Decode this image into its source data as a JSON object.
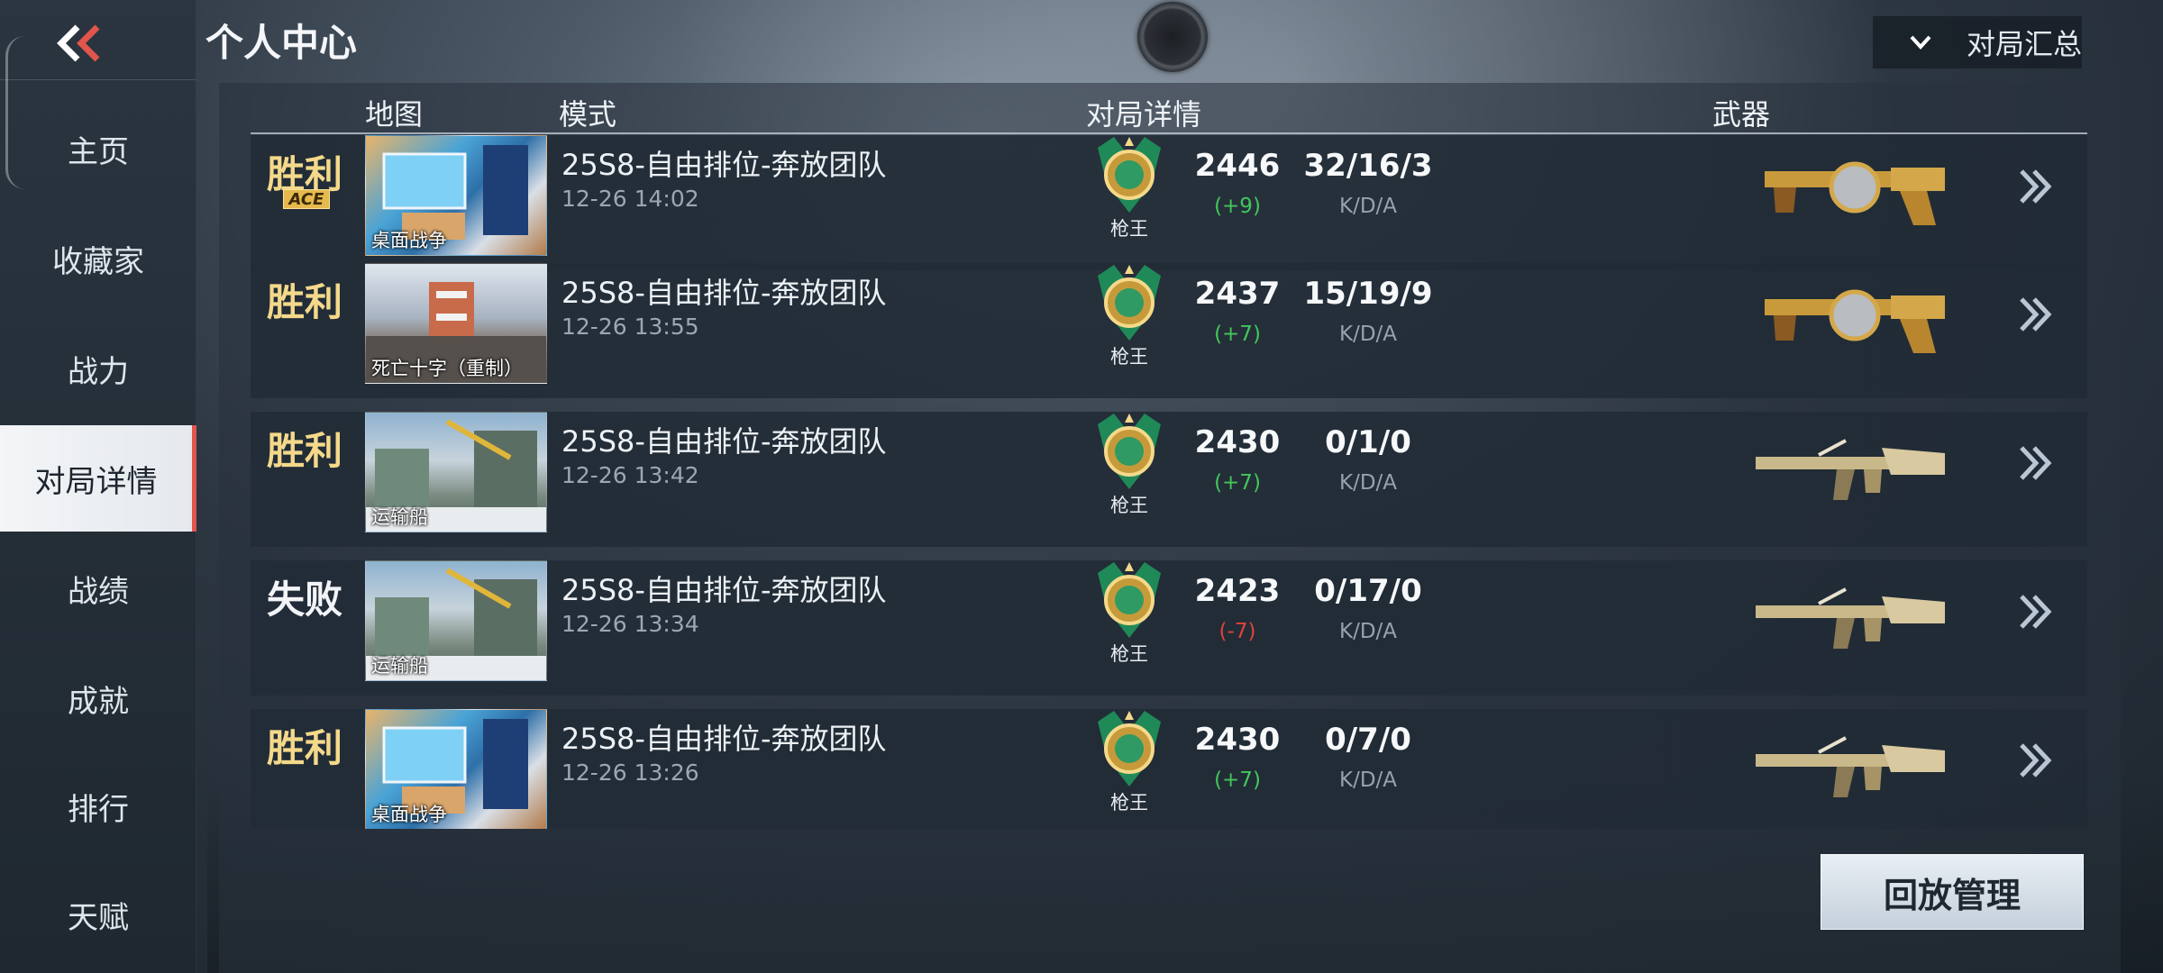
{
  "header": {
    "title": "个人中心",
    "summary_dropdown_label": "对局汇总"
  },
  "sidebar": {
    "items": [
      {
        "label": "主页",
        "active": false
      },
      {
        "label": "收藏家",
        "active": false
      },
      {
        "label": "战力",
        "active": false
      },
      {
        "label": "对局详情",
        "active": true
      },
      {
        "label": "战绩",
        "active": false
      },
      {
        "label": "成就",
        "active": false
      },
      {
        "label": "排行",
        "active": false
      },
      {
        "label": "天赋",
        "active": false
      }
    ]
  },
  "table": {
    "headers": {
      "map": "地图",
      "mode": "模式",
      "details": "对局详情",
      "weapon": "武器"
    },
    "rows": [
      {
        "result": "胜利",
        "result_type": "win",
        "ace": "ACE",
        "map": "桌面战争",
        "mode": "25S8-自由排位-奔放团队",
        "time": "12-26 14:02",
        "rank": "枪王",
        "score": "2446",
        "delta": "(+9)",
        "delta_type": "up",
        "kda": "32/16/3",
        "kda_label": "K/D/A",
        "weapon_icon": "gold-drum-shotgun"
      },
      {
        "result": "胜利",
        "result_type": "win",
        "ace": "",
        "map": "死亡十字（重制）",
        "mode": "25S8-自由排位-奔放团队",
        "time": "12-26 13:55",
        "rank": "枪王",
        "score": "2437",
        "delta": "(+7)",
        "delta_type": "up",
        "kda": "15/19/9",
        "kda_label": "K/D/A",
        "weapon_icon": "gold-drum-shotgun"
      },
      {
        "result": "胜利",
        "result_type": "win",
        "ace": "",
        "map": "运输船",
        "mode": "25S8-自由排位-奔放团队",
        "time": "12-26 13:42",
        "rank": "枪王",
        "score": "2430",
        "delta": "(+7)",
        "delta_type": "up",
        "kda": "0/1/0",
        "kda_label": "K/D/A",
        "weapon_icon": "gold-assault-rifle"
      },
      {
        "result": "失败",
        "result_type": "lose",
        "ace": "",
        "map": "运输船",
        "mode": "25S8-自由排位-奔放团队",
        "time": "12-26 13:34",
        "rank": "枪王",
        "score": "2423",
        "delta": "(-7)",
        "delta_type": "down",
        "kda": "0/17/0",
        "kda_label": "K/D/A",
        "weapon_icon": "gold-assault-rifle"
      },
      {
        "result": "胜利",
        "result_type": "win",
        "ace": "",
        "map": "桌面战争",
        "mode": "25S8-自由排位-奔放团队",
        "time": "12-26 13:26",
        "rank": "枪王",
        "score": "2430",
        "delta": "(+7)",
        "delta_type": "up",
        "kda": "0/7/0",
        "kda_label": "K/D/A",
        "weapon_icon": "gold-assault-rifle"
      }
    ]
  },
  "footer": {
    "replay_button": "回放管理"
  },
  "colors": {
    "win": "#f4d98a",
    "lose": "#f2f4f7",
    "delta_up": "#41c75a",
    "delta_down": "#e0413c",
    "active_marker": "#e2554c"
  }
}
